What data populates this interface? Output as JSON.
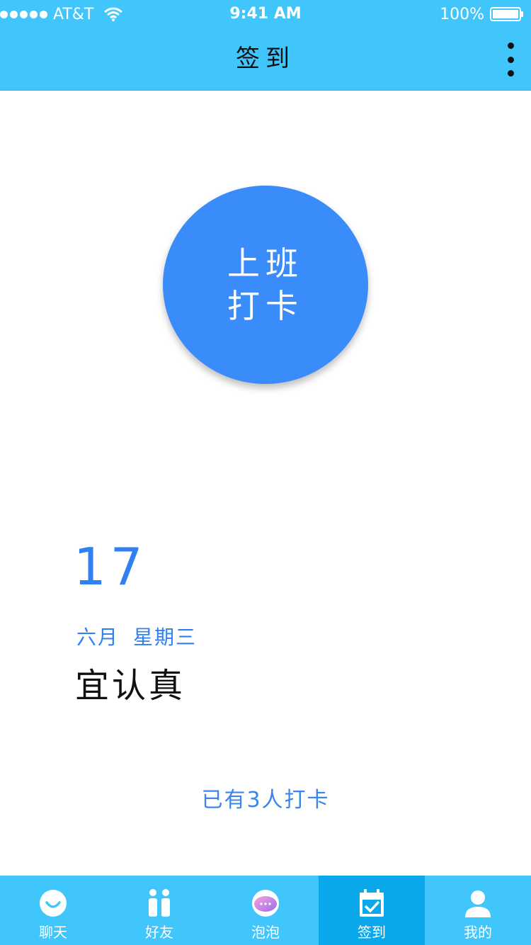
{
  "status_bar": {
    "carrier": "AT&T",
    "time": "9:41 AM",
    "battery": "100%"
  },
  "nav": {
    "title": "签到"
  },
  "checkin_button": {
    "line1": "上班",
    "line2": "打卡"
  },
  "date": {
    "day": "17",
    "month": "六月",
    "weekday": "星期三",
    "motto": "宜认真"
  },
  "checkin_count": "已有3人打卡",
  "tabs": [
    {
      "label": "聊天",
      "icon": "chat-face-icon"
    },
    {
      "label": "好友",
      "icon": "friends-icon"
    },
    {
      "label": "泡泡",
      "icon": "bubble-icon"
    },
    {
      "label": "签到",
      "icon": "calendar-check-icon",
      "active": true
    },
    {
      "label": "我的",
      "icon": "user-icon"
    }
  ],
  "colors": {
    "bar": "#41c6fc",
    "active_tab": "#0aa8ea",
    "primary": "#3a8cfb",
    "accent_text": "#2f80f0"
  }
}
